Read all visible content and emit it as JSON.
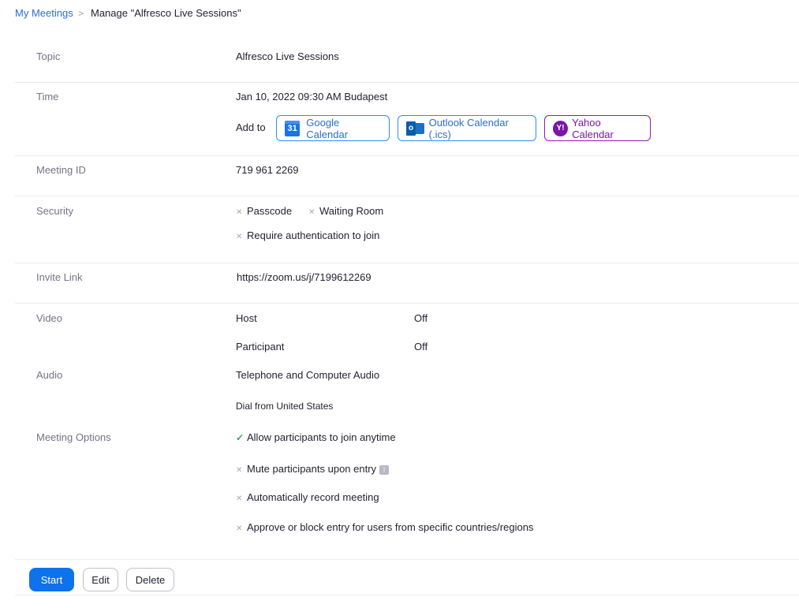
{
  "breadcrumb": {
    "parent": "My Meetings",
    "separator": ">",
    "current": "Manage \"Alfresco Live Sessions\""
  },
  "topic": {
    "label": "Topic",
    "value": "Alfresco Live Sessions"
  },
  "time": {
    "label": "Time",
    "value": "Jan 10, 2022 09:30 AM Budapest",
    "add_to_label": "Add to",
    "calendars": {
      "google": {
        "label": "Google Calendar",
        "icon_text": "31",
        "icon": "google-calendar-icon"
      },
      "outlook": {
        "label": "Outlook Calendar (.ics)",
        "icon_text": "o",
        "icon": "outlook-icon"
      },
      "yahoo": {
        "label": "Yahoo Calendar",
        "icon_text": "Y!",
        "icon": "yahoo-icon"
      }
    }
  },
  "meeting_id": {
    "label": "Meeting ID",
    "value": "719 961 2269"
  },
  "security": {
    "label": "Security",
    "passcode": "Passcode",
    "waiting_room": "Waiting Room",
    "require_auth": "Require authentication to join"
  },
  "invite_link": {
    "label": "Invite Link",
    "value": "https://zoom.us/j/7199612269"
  },
  "video": {
    "label": "Video",
    "host_label": "Host",
    "host_value": "Off",
    "participant_label": "Participant",
    "participant_value": "Off"
  },
  "audio": {
    "label": "Audio",
    "value": "Telephone and Computer Audio",
    "dial_from_label": "Dial from",
    "dial_from_value": "United States"
  },
  "meeting_options": {
    "label": "Meeting Options",
    "allow_join_anytime": "Allow participants to join anytime",
    "mute_upon_entry": "Mute participants upon entry",
    "auto_record": "Automatically record meeting",
    "approve_block": "Approve or block entry for users from specific countries/regions"
  },
  "actions": {
    "start": "Start",
    "edit": "Edit",
    "delete": "Delete"
  },
  "colors": {
    "link": "#2d6dd0",
    "primary": "#0e72ed",
    "yahoo": "#7b16a8",
    "check": "#23b45b"
  }
}
